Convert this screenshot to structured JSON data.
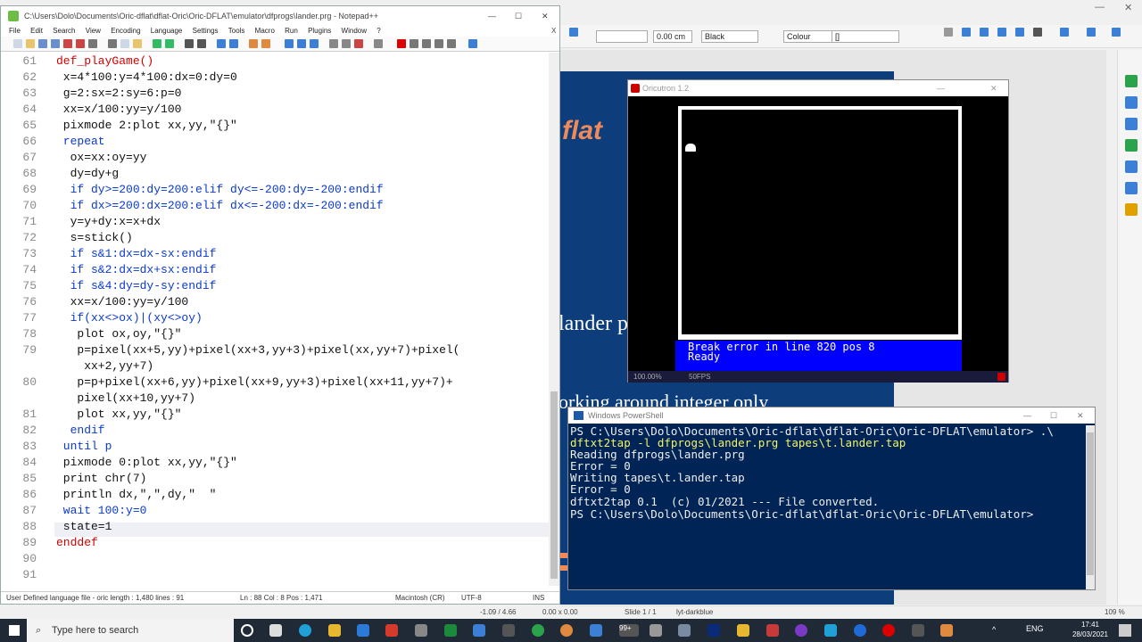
{
  "notepad": {
    "title": "C:\\Users\\Dolo\\Documents\\Oric-dflat\\dflat-Oric\\Oric-DFLAT\\emulator\\dfprogs\\lander.prg - Notepad++",
    "menu": [
      "File",
      "Edit",
      "Search",
      "View",
      "Encoding",
      "Language",
      "Settings",
      "Tools",
      "Macro",
      "Run",
      "Plugins",
      "Window",
      "?"
    ],
    "close_x": "X",
    "lines": [
      {
        "n": "61",
        "t": "def_playGame()"
      },
      {
        "n": "62",
        "t": " x=4*100:y=4*100:dx=0:dy=0"
      },
      {
        "n": "63",
        "t": " g=2:sx=2:sy=6:p=0"
      },
      {
        "n": "64",
        "t": " xx=x/100:yy=y/100"
      },
      {
        "n": "65",
        "t": " pixmode 2:plot xx,yy,\"{}\""
      },
      {
        "n": "66",
        "t": " repeat"
      },
      {
        "n": "67",
        "t": "  ox=xx:oy=yy"
      },
      {
        "n": "68",
        "t": "  dy=dy+g"
      },
      {
        "n": "69",
        "t": "  if dy>=200:dy=200:elif dy<=-200:dy=-200:endif"
      },
      {
        "n": "70",
        "t": "  if dx>=200:dx=200:elif dx<=-200:dx=-200:endif"
      },
      {
        "n": "71",
        "t": "  y=y+dy:x=x+dx"
      },
      {
        "n": "72",
        "t": "  s=stick()"
      },
      {
        "n": "73",
        "t": "  if s&1:dx=dx-sx:endif"
      },
      {
        "n": "74",
        "t": "  if s&2:dx=dx+sx:endif"
      },
      {
        "n": "75",
        "t": "  if s&4:dy=dy-sy:endif"
      },
      {
        "n": "76",
        "t": "  xx=x/100:yy=y/100"
      },
      {
        "n": "77",
        "t": "  if(xx<>ox)|(xy<>oy)"
      },
      {
        "n": "78",
        "t": "   plot ox,oy,\"{}\""
      },
      {
        "n": "79",
        "t": "   p=pixel(xx+5,yy)+pixel(xx+3,yy+3)+pixel(xx,yy+7)+pixel("
      },
      {
        "n": "",
        "t": "    xx+2,yy+7)"
      },
      {
        "n": "80",
        "t": "   p=p+pixel(xx+6,yy)+pixel(xx+9,yy+3)+pixel(xx+11,yy+7)+"
      },
      {
        "n": "",
        "t": "   pixel(xx+10,yy+7)"
      },
      {
        "n": "81",
        "t": "   plot xx,yy,\"{}\""
      },
      {
        "n": "82",
        "t": "  endif"
      },
      {
        "n": "83",
        "t": " until p"
      },
      {
        "n": "84",
        "t": " pixmode 0:plot xx,yy,\"{}\""
      },
      {
        "n": "85",
        "t": " print chr(7)"
      },
      {
        "n": "86",
        "t": " println dx,\",\",dy,\"  \""
      },
      {
        "n": "87",
        "t": " wait 100:y=0"
      },
      {
        "n": "88",
        "t": " state=1"
      },
      {
        "n": "89",
        "t": "enddef"
      },
      {
        "n": "90",
        "t": ""
      },
      {
        "n": "91",
        "t": ""
      }
    ],
    "status": {
      "file_type": "User Defined language file - oric length : 1,480    lines : 91",
      "position": "Ln : 88    Col : 8    Pos : 1,471",
      "eol": "Macintosh (CR)",
      "encoding": "UTF-8",
      "mode": "INS"
    }
  },
  "oricutron": {
    "title": "Oricutron 1.2",
    "screen_line1": "Break error in line 820 pos 8",
    "screen_line2": "Ready",
    "zoom": "100.00%",
    "fps": "50FPS"
  },
  "powershell": {
    "title": "Windows PowerShell",
    "lines": [
      "PS C:\\Users\\Dolo\\Documents\\Oric-dflat\\dflat-Oric\\Oric-DFLAT\\emulator> .\\",
      "dftxt2tap -l dfprogs\\lander.prg tapes\\t.lander.tap",
      "Reading dfprogs\\lander.prg",
      "Error = 0",
      "Writing tapes\\t.lander.tap",
      "Error = 0",
      "dftxt2tap 0.1  (c) 01/2021 --- File converted.",
      "PS C:\\Users\\Dolo\\Documents\\Oric-dflat\\dflat-Oric\\Oric-DFLAT\\emulator>"
    ]
  },
  "editor_app": {
    "line_width": "0.00 cm",
    "line_color": "Black",
    "fill_mode": "Colour",
    "fill_value": "[]",
    "slide_title_fragment": "flat",
    "slide_text_fragment": "lander p",
    "slide_text_fragment2": "orking around integer only",
    "status_coords": "-1.09 / 4.66",
    "status_size": "0.00 x 0.00",
    "slide_info": "Slide 1 / 1",
    "layout_name": "lyt-darkblue",
    "zoom": "109 %"
  },
  "taskbar": {
    "search_placeholder": "Type here to search",
    "time": "17:41",
    "date": "28/03/2021",
    "language": "ENG",
    "badge": "99+"
  },
  "colors": {
    "keyword": "#d40000",
    "builtin": "#0a3ad1",
    "slide_bg": "#0d3d7a",
    "ps_bg": "#012456",
    "oric_blue": "#0000ff"
  }
}
